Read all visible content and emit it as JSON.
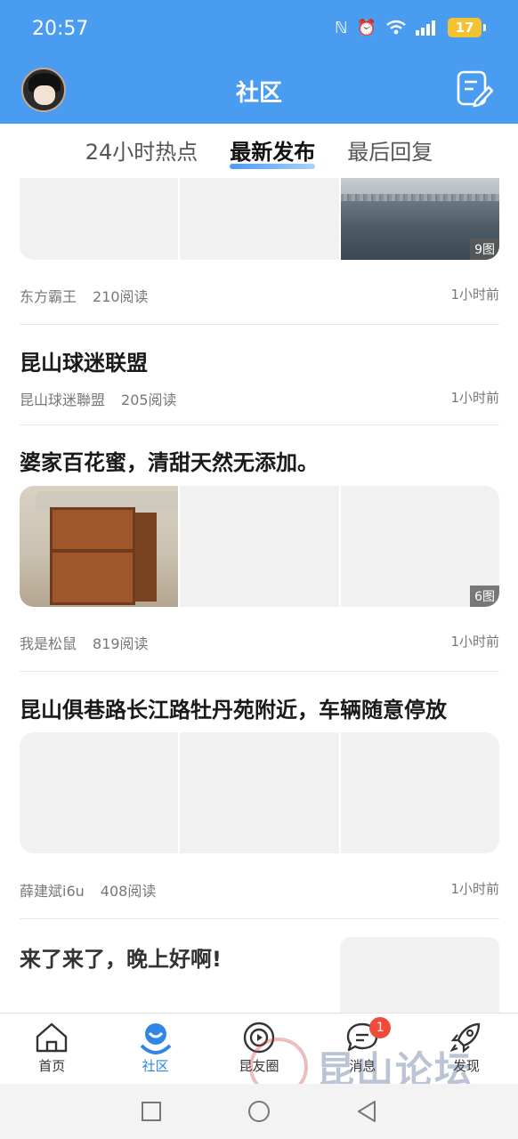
{
  "status_bar": {
    "time": "20:57",
    "battery": "17"
  },
  "header": {
    "title": "社区"
  },
  "tabs": [
    {
      "label": "24小时热点"
    },
    {
      "label": "最新发布"
    },
    {
      "label": "最后回复"
    }
  ],
  "posts": [
    {
      "title": "",
      "author": "东方霸王",
      "reads": "210阅读",
      "time": "1小时前",
      "image_count": "9图"
    },
    {
      "title": "昆山球迷联盟",
      "author": "昆山球迷聯盟",
      "reads": "205阅读",
      "time": "1小时前"
    },
    {
      "title": "婆家百花蜜，清甜天然无添加。",
      "author": "我是松鼠",
      "reads": "819阅读",
      "time": "1小时前",
      "image_count": "6图"
    },
    {
      "title": "昆山俱巷路长江路牡丹苑附近，车辆随意停放",
      "author": "薛建斌i6u",
      "reads": "408阅读",
      "time": "1小时前"
    },
    {
      "title": "来了来了，晚上好啊!"
    }
  ],
  "bottom_nav": [
    {
      "label": "首页"
    },
    {
      "label": "社区"
    },
    {
      "label": "昆友圈"
    },
    {
      "label": "消息",
      "badge": "1"
    },
    {
      "label": "发现"
    }
  ],
  "watermark": {
    "text": "昆山论坛"
  },
  "colors": {
    "brand": "#4a9cf0",
    "active": "#2f86e8",
    "badge": "#f04a3a"
  }
}
